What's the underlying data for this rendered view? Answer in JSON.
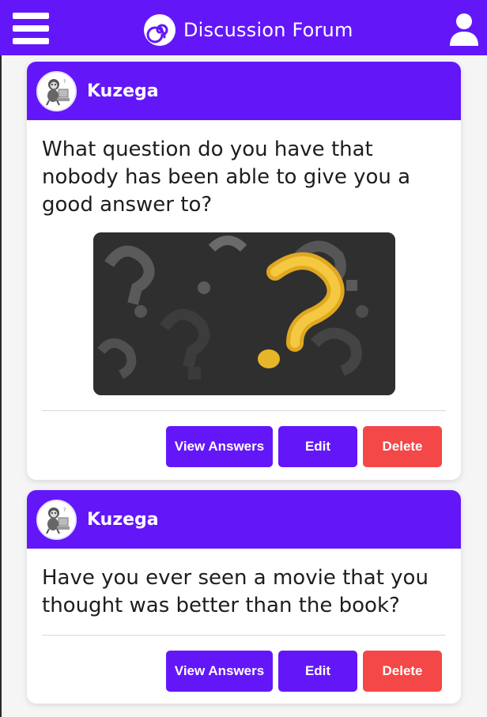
{
  "header": {
    "brand_title": "Discussion Forum",
    "menu_icon": "hamburger-menu-icon",
    "logo_icon": "spiral-logo-icon",
    "profile_icon": "user-profile-icon",
    "accent_color": "#6317f9"
  },
  "posts": [
    {
      "username": "Kuzega",
      "question": "What question do you have that nobody has been able to give you a good answer to?",
      "has_image": true,
      "image_alt": "question-marks-image",
      "view_label": "View Answers",
      "edit_label": "Edit",
      "delete_label": "Delete"
    },
    {
      "username": "Kuzega",
      "question": "Have you ever seen a movie that you thought was better than the book?",
      "has_image": false,
      "view_label": "View Answers",
      "edit_label": "Edit",
      "delete_label": "Delete"
    }
  ],
  "colors": {
    "primary": "#6317f9",
    "danger": "#f44747"
  }
}
